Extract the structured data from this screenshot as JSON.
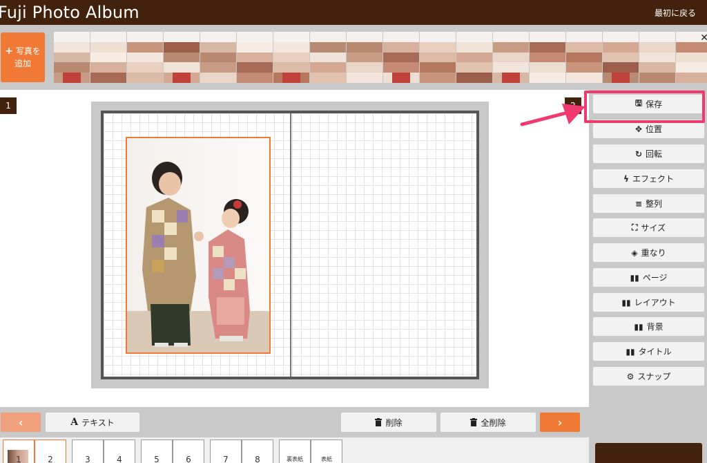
{
  "header": {
    "title": "Fuji Photo Album",
    "back_label": "最初に戻る"
  },
  "photo_strip": {
    "add_label_line1": "写真を",
    "add_label_line2": "追加",
    "close_glyph": "✕"
  },
  "pages": {
    "left_number": "1",
    "right_number": "2"
  },
  "tools": [
    {
      "icon": "floppy-disk-icon",
      "glyph": "🖫",
      "label": "保存"
    },
    {
      "icon": "move-arrows-icon",
      "glyph": "✥",
      "label": "位置"
    },
    {
      "icon": "rotate-icon",
      "glyph": "↻",
      "label": "回転"
    },
    {
      "icon": "lightning-bolt-icon",
      "glyph": "ϟ",
      "label": "エフェクト"
    },
    {
      "icon": "align-lines-icon",
      "glyph": "≡",
      "label": "整列"
    },
    {
      "icon": "expand-corners-icon",
      "glyph": "⛶",
      "label": "サイズ"
    },
    {
      "icon": "layers-icon",
      "glyph": "◈",
      "label": "重なり"
    },
    {
      "icon": "open-book-icon",
      "glyph": "▮▮",
      "label": "ページ"
    },
    {
      "icon": "open-book-icon",
      "glyph": "▮▮",
      "label": "レイアウト"
    },
    {
      "icon": "open-book-icon",
      "glyph": "▮▮",
      "label": "背景"
    },
    {
      "icon": "open-book-icon",
      "glyph": "▮▮",
      "label": "タイトル"
    },
    {
      "icon": "gear-icon",
      "glyph": "⚙",
      "label": "スナップ"
    }
  ],
  "bottom_bar": {
    "prev_glyph": "‹",
    "next_glyph": "›",
    "text_icon": "A",
    "text_label": "テキスト",
    "delete_label": "削除",
    "delete_all_label": "全削除"
  },
  "page_thumbs": [
    {
      "left": "1",
      "right": "2"
    },
    {
      "left": "3",
      "right": "4"
    },
    {
      "left": "5",
      "right": "6"
    },
    {
      "left": "7",
      "right": "8"
    },
    {
      "left": "裏表紙",
      "right": "表紙"
    }
  ],
  "colors": {
    "brand_brown": "#43220d",
    "accent_orange": "#f07a35",
    "highlight_pink": "#f0396e",
    "panel_gray": "#c9c9c9"
  }
}
